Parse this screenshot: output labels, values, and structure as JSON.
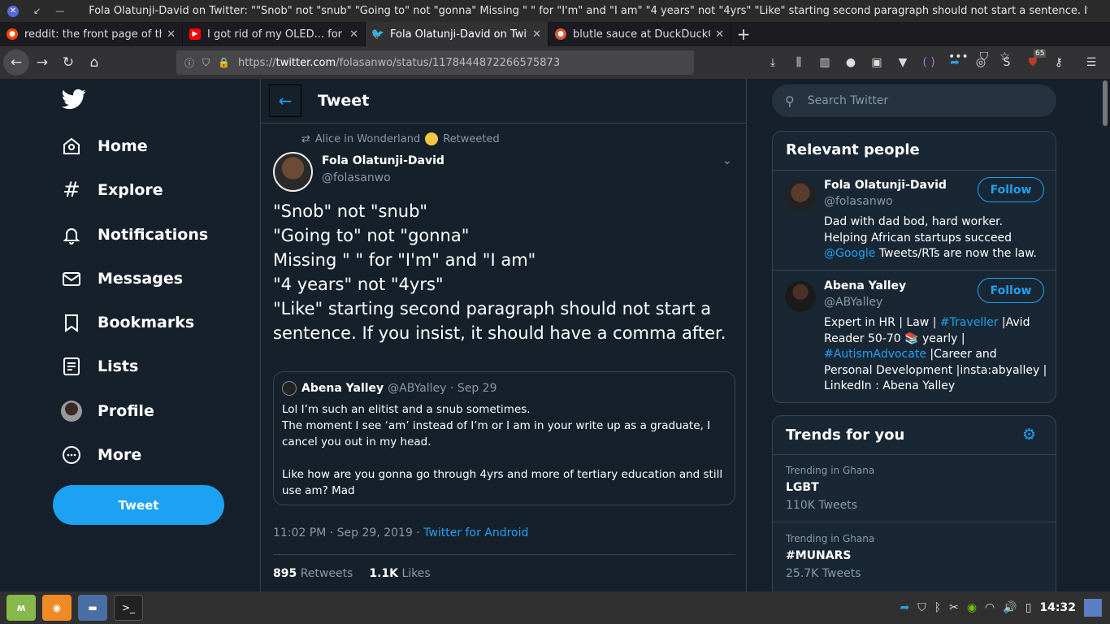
{
  "window": {
    "title": "Fola Olatunji-David on Twitter: \"\"Snob\" not \"snub\" \"Going to\" not \"gonna\" Missing \" \" for \"I'm\" and \"I am\" \"4 years\" not \"4yrs\" \"Like\" starting second paragraph should not start a sentence. If you i..."
  },
  "tabs": [
    {
      "label": "reddit: the front page of the",
      "icon": "reddit-icon",
      "color": "#ff4500"
    },
    {
      "label": "I got rid of my OLED... for a",
      "icon": "youtube-icon",
      "color": "#ff0000"
    },
    {
      "label": "Fola Olatunji-David on Twit",
      "icon": "twitter-icon",
      "color": "#1da1f2"
    },
    {
      "label": "blutle sauce at DuckDuckG",
      "icon": "duckduckgo-icon",
      "color": "#de5833"
    }
  ],
  "urlbar": {
    "url_prefix": "https://",
    "url_domain": "twitter.com",
    "url_path": "/folasanwo/status/1178444872266575873",
    "badge": "65"
  },
  "nav": {
    "items": [
      {
        "label": "Home",
        "icon": "home-icon"
      },
      {
        "label": "Explore",
        "icon": "hashtag-icon"
      },
      {
        "label": "Notifications",
        "icon": "bell-icon"
      },
      {
        "label": "Messages",
        "icon": "envelope-icon"
      },
      {
        "label": "Bookmarks",
        "icon": "bookmark-icon"
      },
      {
        "label": "Lists",
        "icon": "list-icon"
      },
      {
        "label": "Profile",
        "icon": "profile-avatar-icon"
      },
      {
        "label": "More",
        "icon": "more-icon"
      }
    ],
    "tweet_button": "Tweet"
  },
  "main": {
    "header_title": "Tweet",
    "retweeted_by": "Alice in Wonderland",
    "retweeted_label": "Retweeted",
    "author_name": "Fola Olatunji-David",
    "author_handle": "@folasanwo",
    "text": "\"Snob\" not \"snub\"\n\"Going to\" not \"gonna\"\nMissing \" \" for \"I'm\" and \"I am\"\n\"4 years\" not \"4yrs\"\n\"Like\" starting second paragraph should not start a sentence. If you insist, it should have a comma after.",
    "quote": {
      "name": "Abena Yalley",
      "handle": "@ABYalley",
      "date": "Sep 29",
      "text": "Lol I’m such an elitist and a snub sometimes.\nThe moment I see ‘am’ instead of I’m or I am in your write up as a graduate, I cancel you out in my head.\n\nLike how are you gonna go through 4yrs and more of tertiary education and still use am? Mad"
    },
    "timestamp": "11:02 PM · Sep 29, 2019 · ",
    "source": "Twitter for Android",
    "retweets_count": "895",
    "retweets_label": "Retweets",
    "likes_count": "1.1K",
    "likes_label": "Likes"
  },
  "right": {
    "search_placeholder": "Search Twitter",
    "relevant_title": "Relevant people",
    "people": [
      {
        "name": "Fola Olatunji-David",
        "handle": "@folasanwo",
        "follow": "Follow",
        "bio_1": "Dad with dad bod, hard worker. Helping African startups succeed ",
        "bio_link": "@Google",
        "bio_2": " Tweets/RTs are now the law."
      },
      {
        "name": "Abena Yalley",
        "handle": "@ABYalley",
        "follow": "Follow",
        "bio_1": "Expert in HR | Law | ",
        "bio_link": "#Traveller",
        "bio_2": " |Avid Reader 50-70 📚 yearly | ",
        "bio_link2": "#AutismAdvocate",
        "bio_3": " |Career and Personal Development |insta:abyalley | LinkedIn : Abena Yalley"
      }
    ],
    "trends_title": "Trends for you",
    "trends": [
      {
        "context": "Trending in Ghana",
        "title": "LGBT",
        "count": "110K Tweets"
      },
      {
        "context": "Trending in Ghana",
        "title": "#MUNARS",
        "count": "25.7K Tweets"
      }
    ]
  },
  "taskbar": {
    "clock": "14:32"
  }
}
